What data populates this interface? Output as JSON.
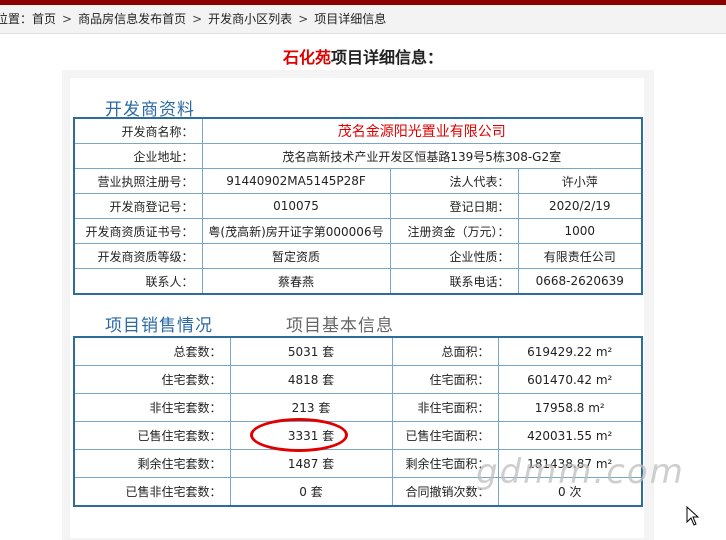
{
  "breadcrumb": {
    "prefix": "位置：",
    "items": [
      "首页",
      "商品房信息发布首页",
      "开发商小区列表",
      "项目详细信息"
    ],
    "separator": ">"
  },
  "title": {
    "project": "石化苑",
    "suffix": "项目详细信息："
  },
  "developer": {
    "section_title": "开发商资料",
    "name_label": "开发商名称：",
    "name_value": "茂名金源阳光置业有限公司",
    "address_label": "企业地址：",
    "address_value": "茂名高新技术产业开发区恒基路139号5栋308-G2室",
    "license_label": "营业执照注册号：",
    "license_value": "91440902MA5145P28F",
    "legal_rep_label": "法人代表：",
    "legal_rep_value": "许小萍",
    "reg_no_label": "开发商登记号：",
    "reg_no_value": "010075",
    "reg_date_label": "登记日期：",
    "reg_date_value": "2020/2/19",
    "cert_label": "开发商资质证书号：",
    "cert_value": "粤(茂高新)房开证字第000006号",
    "capital_label": "注册资金（万元）：",
    "capital_value": "1000",
    "grade_label": "开发商资质等级：",
    "grade_value": "暂定资质",
    "nature_label": "企业性质：",
    "nature_value": "有限责任公司",
    "contact_label": "联系人：",
    "contact_value": "蔡春燕",
    "phone_label": "联系电话：",
    "phone_value": "0668-2620639"
  },
  "sales": {
    "tab_active": "项目销售情况",
    "tab_inactive": "项目基本信息",
    "rows": [
      {
        "l1": "总套数：",
        "v1": "5031 套",
        "l2": "总面积：",
        "v2": "619429.22 m²"
      },
      {
        "l1": "住宅套数：",
        "v1": "4818 套",
        "l2": "住宅面积：",
        "v2": "601470.42 m²"
      },
      {
        "l1": "非住宅套数：",
        "v1": "213 套",
        "l2": "非住宅面积：",
        "v2": "17958.8 m²"
      },
      {
        "l1": "已售住宅套数：",
        "v1": "3331 套",
        "l2": "已售住宅面积：",
        "v2": "420031.55 m²"
      },
      {
        "l1": "剩余住宅套数：",
        "v1": "1487 套",
        "l2": "剩余住宅面积：",
        "v2": "181438.87 m²"
      },
      {
        "l1": "已售非住宅套数：",
        "v1": "0 套",
        "l2": "合同撤销次数：",
        "v2": "0 次"
      }
    ]
  },
  "watermark": "gdmm.com",
  "colors": {
    "accent_red": "#e00000",
    "section_blue": "#2b6aa5",
    "table_border": "#2d6d9a",
    "topbar": "#8b0000"
  }
}
